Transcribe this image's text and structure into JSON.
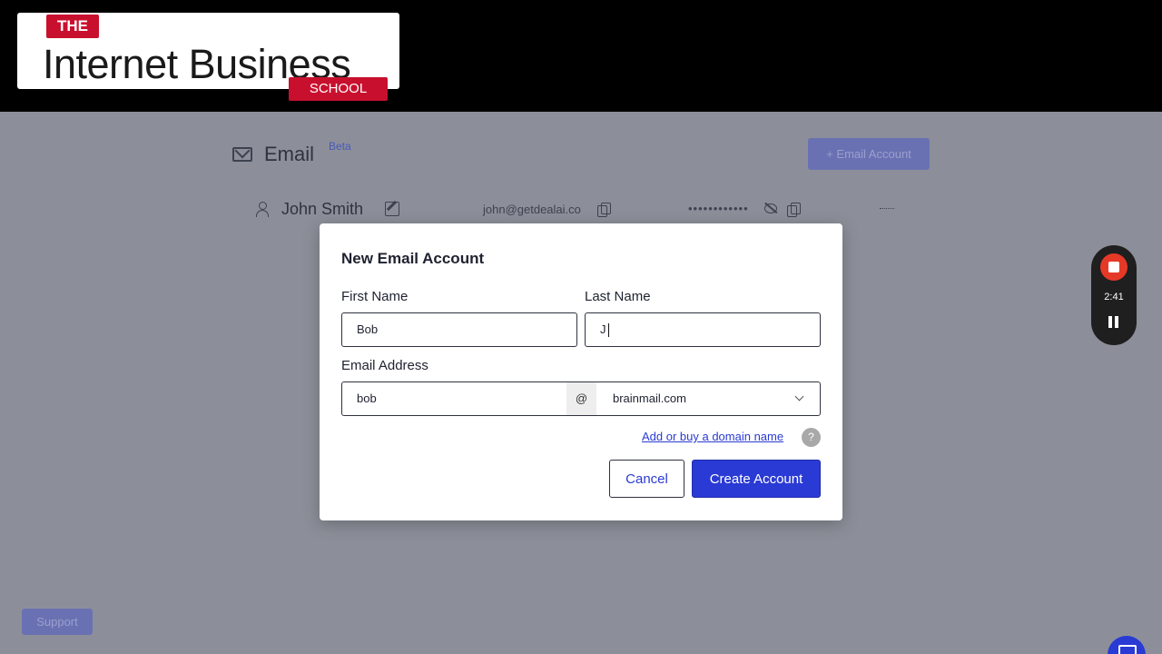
{
  "logo": {
    "the": "THE",
    "main": "Internet Business",
    "school": "SCHOOL"
  },
  "header": {
    "title": "Email",
    "badge": "Beta",
    "add_button": "+ Email Account"
  },
  "account_row": {
    "name": "John Smith",
    "email": "john@getdealai.co",
    "password_mask": "••••••••••••"
  },
  "recorder": {
    "time": "2:41"
  },
  "support": {
    "label": "Support"
  },
  "modal": {
    "title": "New Email Account",
    "first_name_label": "First Name",
    "first_name_value": "Bob",
    "last_name_label": "Last Name",
    "last_name_value": "J",
    "email_label": "Email Address",
    "email_local": "bob",
    "at": "@",
    "domain": "brainmail.com",
    "domain_link": "Add or buy a domain name",
    "help": "?",
    "cancel": "Cancel",
    "create": "Create Account"
  },
  "colors": {
    "primary": "#2a3ad4",
    "overlay": "#8c8f99",
    "logo_red": "#c8102e",
    "recorder_red": "#e53927"
  }
}
